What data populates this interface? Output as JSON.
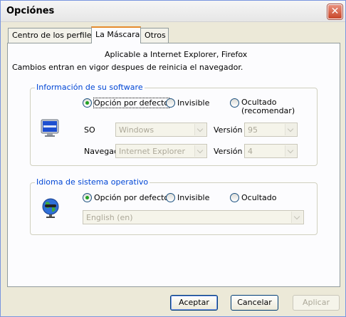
{
  "window": {
    "title": "Opciónes"
  },
  "tabs": [
    {
      "label": "Centro de los perfiles"
    },
    {
      "label": "La Máscara"
    },
    {
      "label": "Otros"
    }
  ],
  "info": {
    "line1": "Aplicable a Internet Explorer, Firefox",
    "line2": "Cambios entran en vigor despues de reinicia el navegador."
  },
  "software_group": {
    "title": "Información de su software",
    "icon": "monitor-icon",
    "radios": [
      {
        "label": "Opción por defecto",
        "checked": true
      },
      {
        "label": "Invisible",
        "checked": false
      },
      {
        "label": "Ocultado",
        "label2": "(recomendar)",
        "checked": false
      }
    ],
    "so_label": "SO",
    "so_value": "Windows",
    "so_version_label": "Versión",
    "so_version_value": "95",
    "nav_label": "Navegac",
    "nav_value": "Internet Explorer",
    "nav_version_label": "Versión",
    "nav_version_value": "4"
  },
  "language_group": {
    "title": "Idioma de sistema operativo",
    "icon": "globe-icon",
    "radios": [
      {
        "label": "Opción por defecto",
        "checked": true
      },
      {
        "label": "Invisible",
        "checked": false
      },
      {
        "label": "Ocultado",
        "checked": false
      }
    ],
    "language_value": "English (en)"
  },
  "buttons": {
    "accept": "Aceptar",
    "cancel": "Cancelar",
    "apply": "Aplicar"
  },
  "colors": {
    "group_title": "#0046d5",
    "active_tab_accent": "#e68b2c",
    "close_button": "#c8462a"
  }
}
